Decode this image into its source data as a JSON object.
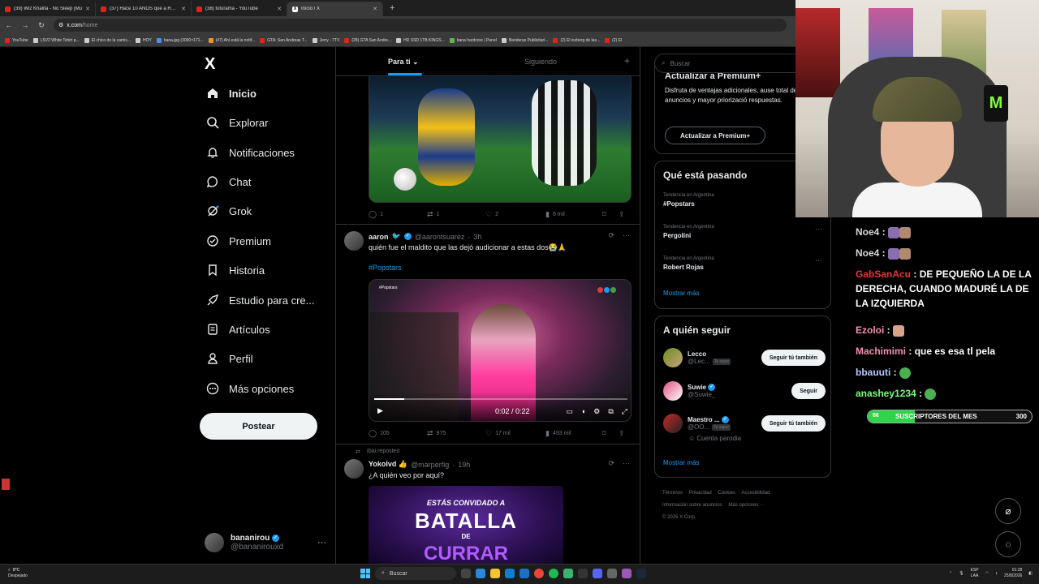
{
  "browser": {
    "tabs": [
      {
        "title": "(39) Wiz Khalifa - No Sleep [Mu",
        "icon": "youtube-icon",
        "active": false
      },
      {
        "title": "(37) Hace 10 AÑOS que a Rock",
        "icon": "youtube-icon",
        "active": false
      },
      {
        "title": "(38) futurama - YouTube",
        "icon": "youtube-icon",
        "active": false
      },
      {
        "title": "Inicio / X",
        "icon": "x-icon",
        "active": true
      }
    ],
    "new_tab": "+",
    "url_host": "x.com",
    "url_path": "/home",
    "bookmarks": [
      "YouTube",
      "LSV2 White Tshirt p...",
      "El chico de la camis...",
      "HOY",
      "bana.jpg (3000×171...",
      "(47) Ahí está la notif...",
      "GTA: San Andreas T...",
      "Jerry - 7TV",
      "(28) GTA San Andre...",
      "HD SSD 1TB KINGS...",
      "bana hardcore | Panel",
      "Banderas Publicitari...",
      "(2) El iceberg de las...",
      "(2) El"
    ]
  },
  "nav": {
    "logo": "X",
    "items": [
      {
        "label": "Inicio",
        "icon": "home-icon"
      },
      {
        "label": "Explorar",
        "icon": "search-icon"
      },
      {
        "label": "Notificaciones",
        "icon": "bell-icon"
      },
      {
        "label": "Chat",
        "icon": "chat-icon"
      },
      {
        "label": "Grok",
        "icon": "grok-icon"
      },
      {
        "label": "Premium",
        "icon": "premium-icon"
      },
      {
        "label": "Historia",
        "icon": "bookmark-icon"
      },
      {
        "label": "Estudio para cre...",
        "icon": "rocket-icon"
      },
      {
        "label": "Artículos",
        "icon": "article-icon"
      },
      {
        "label": "Perfil",
        "icon": "person-icon"
      },
      {
        "label": "Más opciones",
        "icon": "more-icon"
      }
    ],
    "post_button": "Postear",
    "account": {
      "name": "bananirou",
      "handle": "@bananirouxd",
      "more": "···"
    }
  },
  "feed": {
    "tabs": [
      "Para ti",
      "Siguiendo"
    ],
    "tab_plus": "+",
    "tweet1": {
      "replies": "1",
      "reposts": "1",
      "likes": "2",
      "views": "6 mil"
    },
    "tweet2": {
      "name": "aaron",
      "handle": "@aarontsuarez",
      "time": "3h",
      "text": "quién fue el maldito que las dejó audicionar a estas dos😭🙏",
      "hashtag": "#Popstars",
      "video_badge": "#Popstars",
      "video_time": "0:02 / 0:22",
      "video_progress": 0.12,
      "replies": "105",
      "reposts": "975",
      "likes": "17 mil",
      "views": "493 mil"
    },
    "tweet3": {
      "repost_by": "Ibai reposteó",
      "name": "Yokolvd 👍",
      "handle": "@marperfig",
      "time": "19h",
      "text": "¿A quién veo por aquí?",
      "poster_line1": "ESTÁS CONVIDADO A",
      "poster_line2": "BATALLA",
      "poster_line3": "DE",
      "poster_line4": "CURRAR"
    }
  },
  "right": {
    "search_placeholder": "Buscar",
    "premium": {
      "title": "Actualizar a Premium+",
      "desc": "Disfruta de ventajas adicionales, ause total de anuncios y mayor priorizació respuestas.",
      "button": "Actualizar a Premium+"
    },
    "trends_title": "Qué está pasando",
    "trends": [
      {
        "context": "Tendencia en Argentina",
        "label": "#Popstars"
      },
      {
        "context": "Tendencia en Argentina",
        "label": "Pergolini"
      },
      {
        "context": "Tendencia en Argentina",
        "label": "Robert Rojas"
      }
    ],
    "show_more": "Mostrar más",
    "follow_title": "A quién seguir",
    "follow": [
      {
        "name": "Lecco",
        "handle": "@Lec...",
        "tag": "Te sigue",
        "button": "Seguir tú también"
      },
      {
        "name": "Suwie",
        "handle": "@Suwie_",
        "tag": "",
        "button": "Seguir"
      },
      {
        "name": "Maestro ...",
        "handle": "@OO...",
        "tag": "Te sigue",
        "button": "Seguir tú también"
      }
    ],
    "parody": "Cuenta parodia",
    "footer": [
      "Términos",
      "Privacidad",
      "Cookies",
      "Accesibilidad",
      "Información sobre anuncios",
      "Más opciones ···",
      "© 2026 X Corp."
    ]
  },
  "stream": {
    "chat": [
      {
        "user": "Noe4",
        "color": "#d8d8d8",
        "text": ""
      },
      {
        "user": "Noe4",
        "color": "#d8d8d8",
        "text": ""
      },
      {
        "user": "GabSanAcu",
        "color": "#e53935",
        "text": "DE PEQUEÑO LA DE LA DERECHA, CUANDO MADURÉ LA DE LA IZQUIERDA"
      },
      {
        "user": "Ezoloi",
        "color": "#f48fb1",
        "text": ""
      },
      {
        "user": "Machimimi",
        "color": "#f48fb1",
        "text": "que es esa tl pela"
      },
      {
        "user": "bbauuti",
        "color": "#b3c7ff",
        "text": ""
      },
      {
        "user": "anashey1234",
        "color": "#76ff7a",
        "text": ""
      }
    ],
    "sub_goal": {
      "current": "86",
      "label": "SUSCRIPTORES DEL MES",
      "goal": "300",
      "fraction": 0.287
    },
    "can_logo": "M"
  },
  "taskbar": {
    "temp": "8°C",
    "weather": "Despejado",
    "search": "Buscar",
    "lang1": "ESP",
    "lang2": "LAA",
    "time": "01:28",
    "date": "25/8/2026"
  },
  "colors": {
    "accent": "#1d9bf0",
    "bg": "#000000",
    "sub_green": "#2fd44a"
  }
}
